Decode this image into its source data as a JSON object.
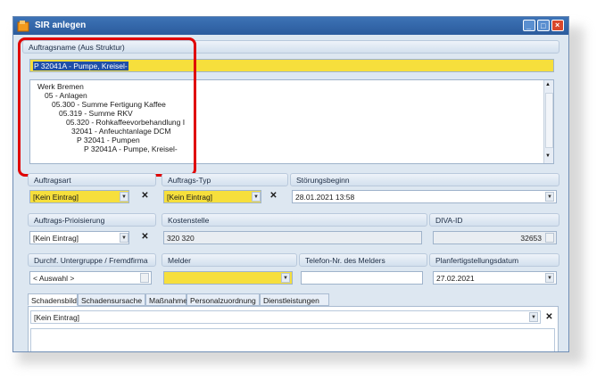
{
  "window": {
    "title": "SIR anlegen"
  },
  "auftragsname": {
    "label": "Auftragsname (Aus Struktur)",
    "value": "P 32041A - Pumpe, Kreisel-",
    "tree": [
      "Werk Bremen",
      "05 - Anlagen",
      "05.300 - Summe Fertigung Kaffee",
      "05.319 - Summe RKV",
      "05.320 - Rohkaffeevorbehandlung I",
      "32041 - Anfeuchtanlage DCM",
      "P 32041 - Pumpen",
      "P 32041A - Pumpe, Kreisel-"
    ]
  },
  "row1": {
    "auftragsart": {
      "label": "Auftragsart",
      "value": "[Kein Eintrag]"
    },
    "auftragstyp": {
      "label": "Auftrags-Typ",
      "value": "[Kein Eintrag]"
    },
    "stoerungsbeginn": {
      "label": "Störungsbeginn",
      "value": "28.01.2021 13:58"
    }
  },
  "row2": {
    "priorisierung": {
      "label": "Auftrags-Prioisierung",
      "value": "[Kein Eintrag]"
    },
    "kostenstelle": {
      "label": "Kostenstelle",
      "value": "320 320"
    },
    "diva": {
      "label": "DIVA-ID",
      "value": "32653"
    }
  },
  "row3": {
    "untergruppe": {
      "label": "Durchf. Untergruppe / Fremdfirma",
      "value": "< Auswahl >"
    },
    "melder": {
      "label": "Melder",
      "value": ""
    },
    "telefon": {
      "label": "Telefon-Nr. des Melders",
      "value": ""
    },
    "planfertig": {
      "label": "Planfertigstellungsdatum",
      "value": "27.02.2021"
    }
  },
  "tabs": [
    "Schadensbild",
    "Schadensursache",
    "Maßnahme",
    "Personalzuordnung",
    "Dienstleistungen"
  ],
  "tab_panel": {
    "value": "[Kein Eintrag]"
  },
  "colors": {
    "title_bar": "#2b5b9d",
    "highlight": "#f6df3c",
    "annotation": "#e00000"
  }
}
